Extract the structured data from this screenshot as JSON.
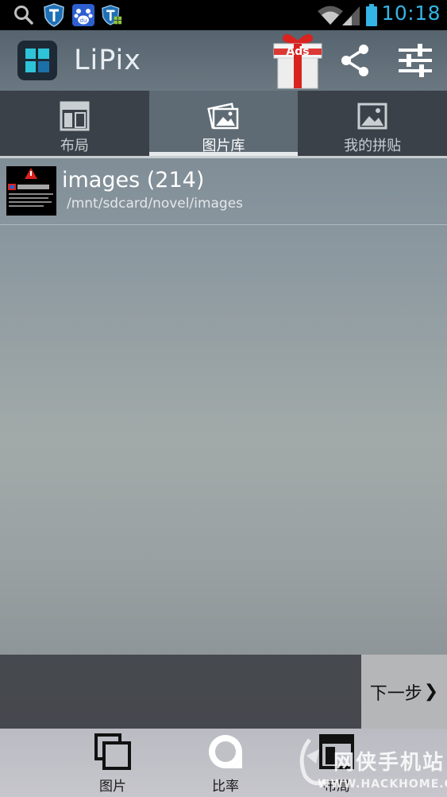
{
  "status_bar": {
    "time": "10:18",
    "icons": [
      "search-icon",
      "shield-t-icon",
      "baidu-icon",
      "shield-t-grid-icon",
      "wifi-icon",
      "signal-icon",
      "battery-icon"
    ]
  },
  "action_bar": {
    "app_name": "LiPix",
    "ads_label": "Ads",
    "icons": [
      "lipix-logo-icon",
      "gift-ads-icon",
      "share-icon",
      "settings-sliders-icon"
    ]
  },
  "tabs": [
    {
      "label": "布局",
      "icon": "layout-icon",
      "active": false
    },
    {
      "label": "图片库",
      "icon": "gallery-icon",
      "active": true
    },
    {
      "label": "我的拼贴",
      "icon": "image-icon",
      "active": false
    }
  ],
  "albums": [
    {
      "name": "images (214)",
      "path": "/mnt/sdcard/novel/images"
    }
  ],
  "next_button": {
    "label": "下一步",
    "arrow": "❯"
  },
  "bottom_nav": [
    {
      "label": "图片",
      "icon": "photos-stack-icon"
    },
    {
      "label": "比率",
      "icon": "ratio-icon"
    },
    {
      "label": "布局",
      "icon": "layout-icon"
    }
  ],
  "watermark": {
    "text": "网侠手机站",
    "url": "WWW.HACKHOME.COM"
  },
  "colors": {
    "clock": "#33b5e5",
    "tab_bg": "#3a4148",
    "tab_active_bg": "#5e6a74",
    "next_button_bg": "#b4b6b8",
    "logo_accent": "#2ec4d8"
  }
}
